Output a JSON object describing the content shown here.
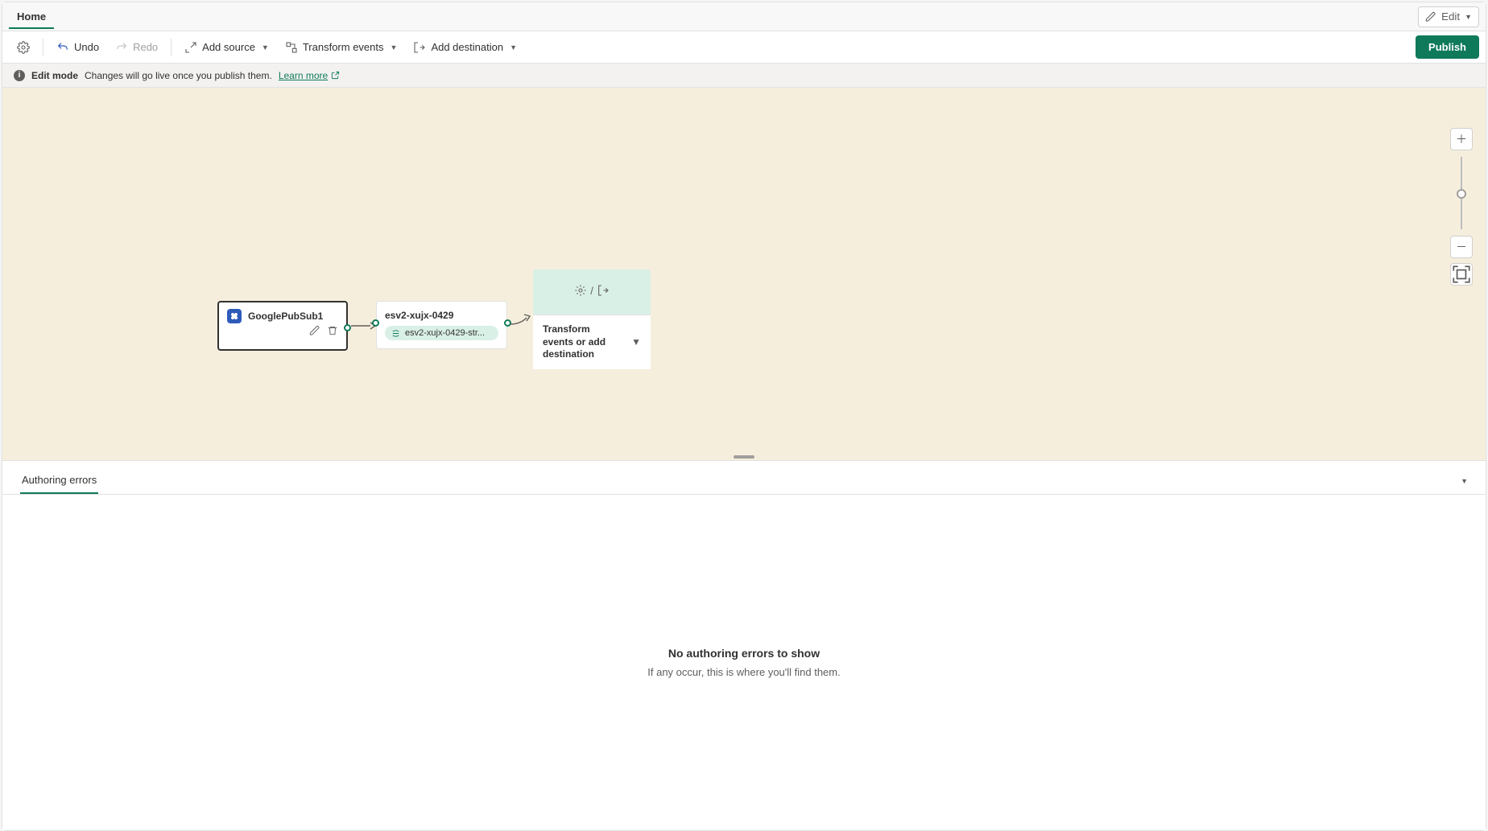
{
  "header": {
    "tab_home": "Home",
    "edit_label": "Edit"
  },
  "toolbar": {
    "undo": "Undo",
    "redo": "Redo",
    "add_source": "Add source",
    "transform_events": "Transform events",
    "add_destination": "Add destination",
    "publish": "Publish"
  },
  "infobar": {
    "mode": "Edit mode",
    "message": "Changes will go live once you publish them.",
    "learn_more": "Learn more"
  },
  "canvas": {
    "source_name": "GooglePubSub1",
    "stream_title": "esv2-xujx-0429",
    "stream_chip": "esv2-xujx-0429-str...",
    "add_label": "Transform events or add destination"
  },
  "bottom_panel": {
    "tab": "Authoring errors",
    "empty_title": "No authoring errors to show",
    "empty_sub": "If any occur, this is where you'll find them."
  }
}
